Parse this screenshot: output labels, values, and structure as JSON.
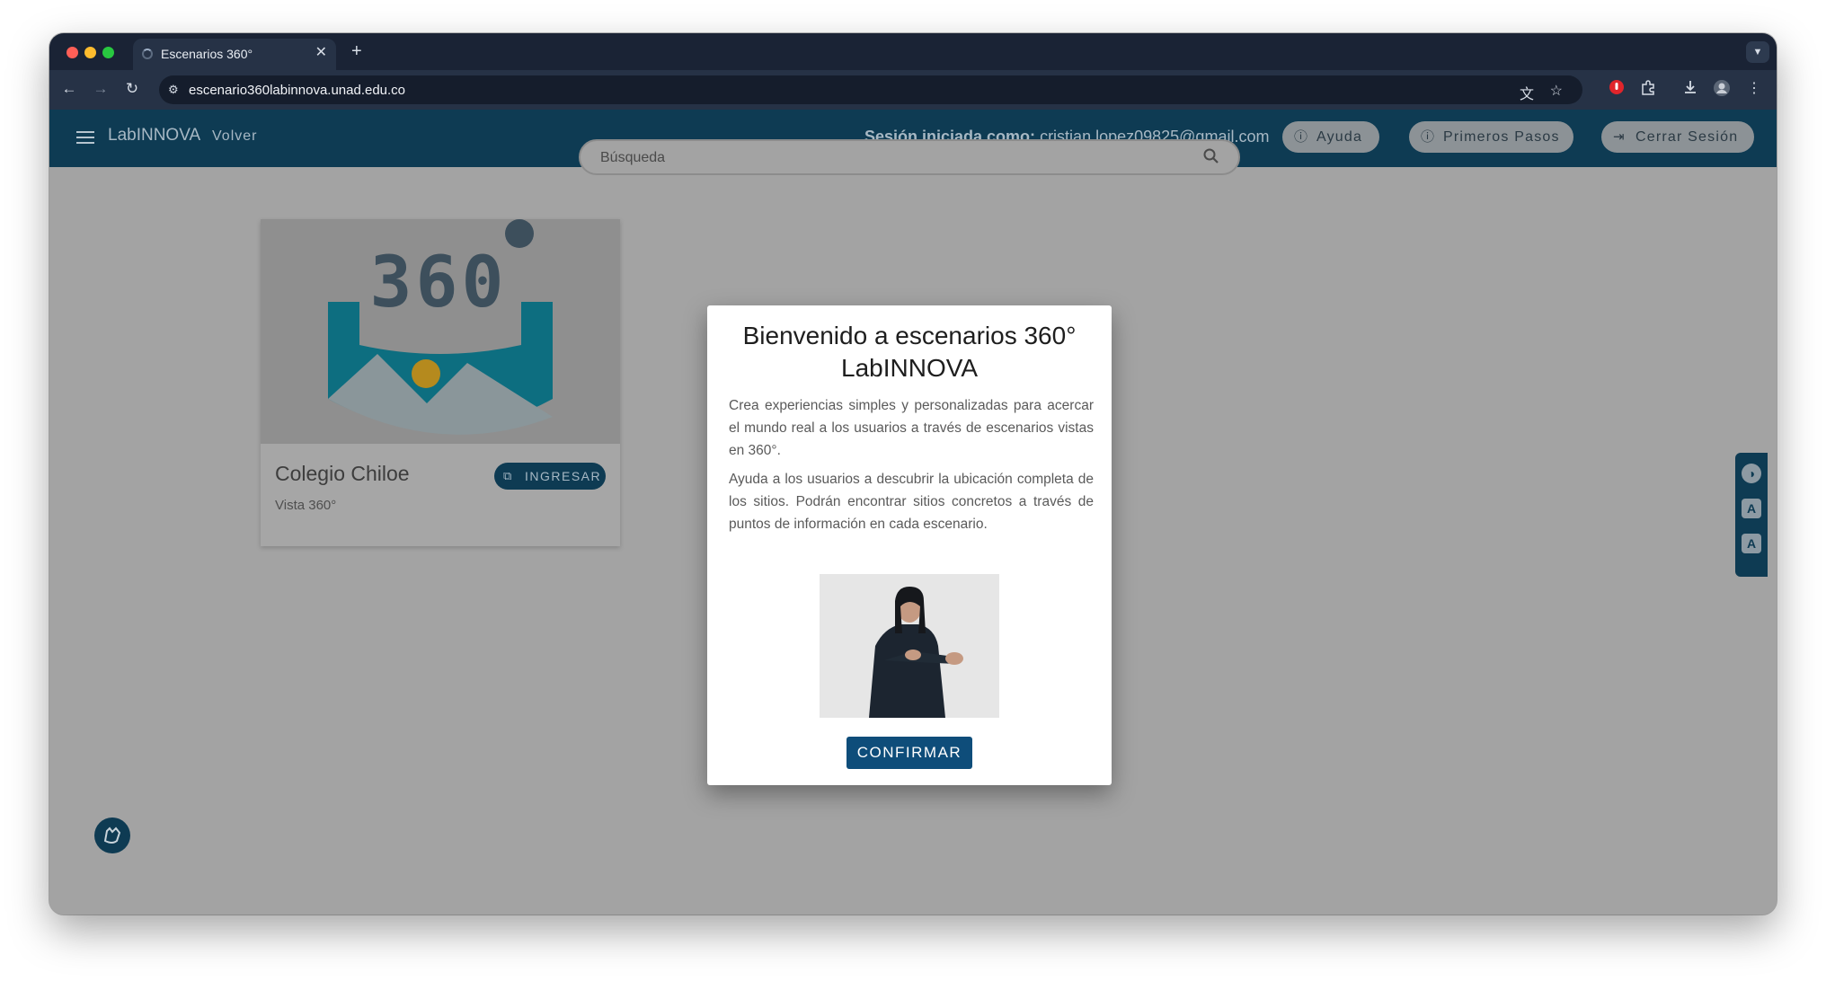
{
  "browser": {
    "tab_title": "Escenarios 360°",
    "new_tab_symbol": "+",
    "url": "escenario360labinnova.unad.edu.co",
    "traffic_colors": [
      "#ff5f57",
      "#febc2e",
      "#28c840"
    ]
  },
  "app": {
    "brand": "LabINNOVA",
    "back_label": "Volver",
    "session_prefix": "Sesión iniciada como:",
    "session_email": "cristian.lopez09825@gmail.com",
    "buttons": {
      "help": "Ayuda",
      "first_steps": "Primeros Pasos",
      "logout": "Cerrar Sesión"
    },
    "search_placeholder": "Búsqueda",
    "accent_color": "#0e3b53"
  },
  "cards": [
    {
      "image_text": "360",
      "title": "Colegio Chiloe",
      "subtitle": "Vista 360°",
      "button": "INGRESAR"
    }
  ],
  "accessibility": {
    "icons": [
      "contrast-icon",
      "font-decrease-icon",
      "font-increase-icon"
    ],
    "decrease_symbol": "A",
    "increase_symbol": "A"
  },
  "modal": {
    "title": "Bienvenido a escenarios 360° LabINNOVA",
    "paragraph_1": "Crea experiencias simples y personalizadas para acercar el mundo real a los usuarios a través de escenarios vistas en 360°.",
    "paragraph_2": "Ayuda a los usuarios a descubrir la ubicación completa de los sitios. Podrán encontrar sitios concretos a través de puntos de información en cada escenario.",
    "confirm_label": "CONFIRMAR"
  }
}
